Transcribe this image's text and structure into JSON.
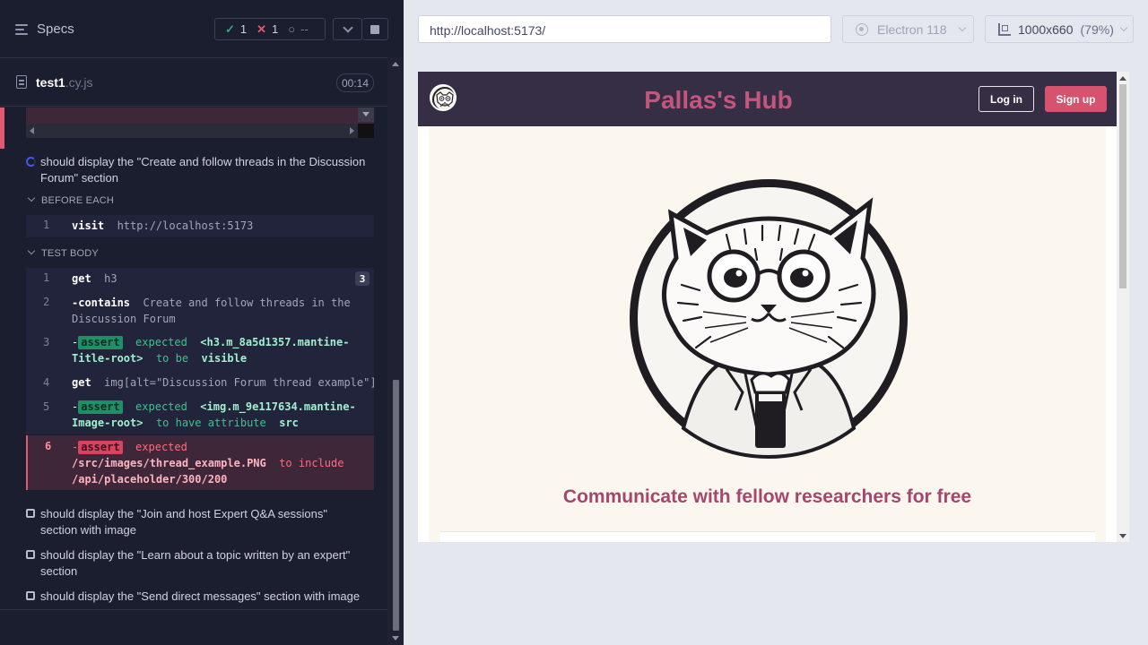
{
  "runner": {
    "specs_label": "Specs",
    "stats": {
      "passed": "1",
      "failed": "1",
      "pending": "--"
    },
    "file": {
      "name": "test1",
      "ext": ".cy.js",
      "duration": "00:14"
    }
  },
  "tests": [
    {
      "title": "should display the \"Create and follow threads in the Discussion Forum\" section",
      "state": "running"
    },
    {
      "title": "should display the \"Join and host Expert Q&A sessions\" section with image",
      "state": "queued"
    },
    {
      "title": "should display the \"Learn about a topic written by an expert\" section",
      "state": "queued"
    },
    {
      "title": "should display the \"Send direct messages\" section with image",
      "state": "queued"
    }
  ],
  "before_each": {
    "label": "BEFORE EACH",
    "commands": [
      {
        "num": "1",
        "name": "visit",
        "arg": "http://localhost:5173"
      }
    ]
  },
  "test_body": {
    "label": "TEST BODY",
    "commands": [
      {
        "num": "1",
        "name": "get",
        "arg": "h3",
        "badge": "3"
      },
      {
        "num": "2",
        "name": "-contains",
        "arg": "Create and follow threads in the",
        "arg2": "Discussion Forum"
      },
      {
        "num": "3",
        "dash": "-",
        "tag": "assert",
        "w1": "expected",
        "w2": "<h3.m_8a5d1357.mantine-",
        "w3": "Title-root>",
        "w4": "to be",
        "w5": "visible"
      },
      {
        "num": "4",
        "name": "get",
        "arg": "img[alt=\"Discussion Forum thread example\"]"
      },
      {
        "num": "5",
        "dash": "-",
        "tag": "assert",
        "w1": "expected",
        "w2": "<img.m_9e117634.mantine-",
        "w3": "Image-root>",
        "w4": "to have attribute",
        "w5": "src"
      },
      {
        "num": "6",
        "dash": "-",
        "tag": "assert",
        "w1": "expected",
        "w2": "/src/images/thread_example.PNG",
        "w3": "to include",
        "w4": "/api/placeholder/300/200"
      }
    ]
  },
  "browser_bar": {
    "url": "http://localhost:5173/",
    "browser": "Electron 118",
    "viewport": "1000x660",
    "scale": "(79%)"
  },
  "app": {
    "brand": "Pallas's Hub",
    "login_label": "Log in",
    "signup_label": "Sign up",
    "tagline": "Communicate with fellow researchers for free",
    "colors": {
      "header": "#362e44",
      "brand": "#c2577e",
      "signup": "#d6526f",
      "tagline": "#a6466e",
      "main_bg": "#fbf7ef"
    }
  },
  "icons": {
    "specs": "hamburger-icon",
    "passed": "check-icon",
    "failed": "x-icon",
    "pending": "spinner-icon",
    "file": "document-icon",
    "browser": "electron-icon",
    "viewport": "ruler-icon"
  }
}
